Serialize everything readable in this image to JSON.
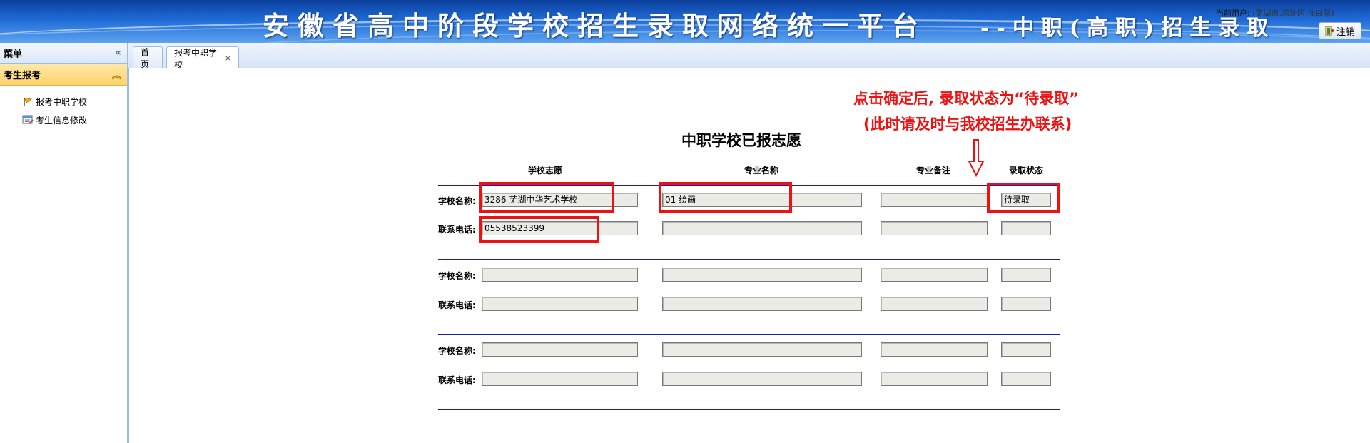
{
  "header": {
    "title": "安徽省高中阶段学校招生录取网络统一平台",
    "subtitle": "--中职(高职)招生录取",
    "current_user_label": "当前用户:",
    "current_user": "(芜湖市.湾沚区.沈白慧)",
    "logout_label": "注销"
  },
  "sidebar": {
    "menu_label": "菜单",
    "section_label": "考生报考",
    "items": [
      {
        "label": "报考中职学校",
        "icon": "flag-icon"
      },
      {
        "label": "考生信息修改",
        "icon": "edit-icon"
      }
    ]
  },
  "tabs": [
    {
      "label": "首页"
    },
    {
      "label": "报考中职学校",
      "close": "×"
    }
  ],
  "form": {
    "title": "中职学校已报志愿",
    "columns": [
      "学校志愿",
      "专业名称",
      "专业备注",
      "录取状态"
    ],
    "school_label": "学校名称:",
    "phone_label": "联系电话:",
    "groups": [
      {
        "school": "3286 芜湖中华艺术学校",
        "major": "01 绘画",
        "remark": "",
        "status": "待录取",
        "phone": "05538523399"
      },
      {
        "school": "",
        "major": "",
        "remark": "",
        "status": "",
        "phone": ""
      },
      {
        "school": "",
        "major": "",
        "remark": "",
        "status": "",
        "phone": ""
      }
    ]
  },
  "annotation": {
    "line1": "点击确定后, 录取状态为“待录取”",
    "line2": "(此时请及时与我校招生办联系)",
    "color": "#ee1111"
  }
}
